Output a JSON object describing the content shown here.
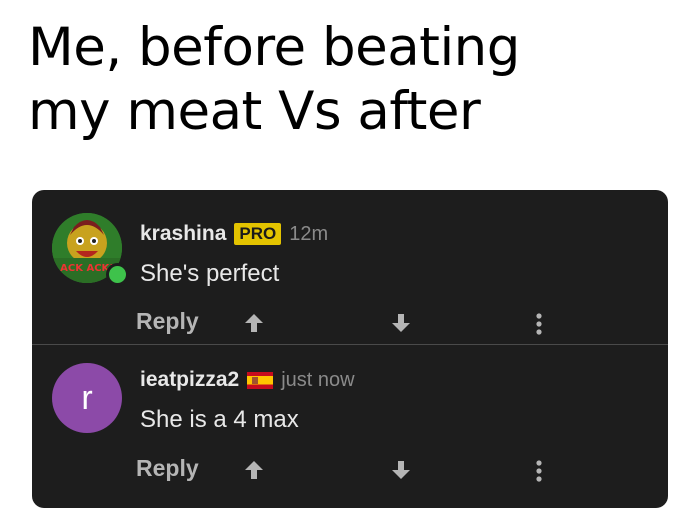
{
  "caption": {
    "line1": "Me, before beating",
    "line2": "my meat Vs after"
  },
  "comments": [
    {
      "username": "krashina",
      "badge": "PRO",
      "time": "12m",
      "text": "She's perfect",
      "reply_label": "Reply",
      "avatar": {
        "type": "image",
        "icon": "cartoon-avatar",
        "online": true,
        "caption_text": "ACK ACK!"
      }
    },
    {
      "username": "ieatpizza2",
      "flag": "spain-flag-icon",
      "time": "just now",
      "text": "She is a 4 max",
      "reply_label": "Reply",
      "avatar": {
        "type": "initial",
        "letter": "r",
        "color": "#8c4aa8"
      }
    }
  ],
  "colors": {
    "panel_bg": "#1d1d1d",
    "badge_bg": "#e3c300",
    "online": "#3ec24b",
    "text": "#e8e8e8",
    "muted": "#8a8a8a"
  }
}
